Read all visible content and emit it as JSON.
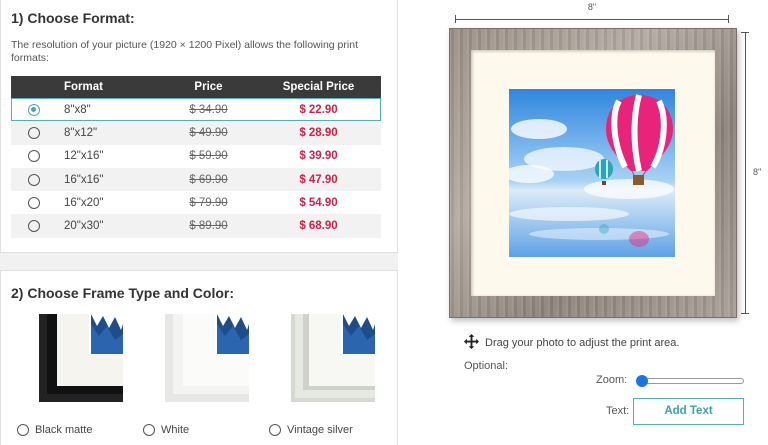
{
  "format_section": {
    "title": "1) Choose Format:",
    "description": "The resolution of your picture (1920 × 1200 Pixel) allows the following print formats:",
    "columns": [
      "Format",
      "Price",
      "Special Price"
    ],
    "rows": [
      {
        "format": "8\"x8\"",
        "price": "$ 34.90",
        "special": "$ 22.90",
        "selected": true
      },
      {
        "format": "8\"x12\"",
        "price": "$ 49.90",
        "special": "$ 28.90",
        "selected": false
      },
      {
        "format": "12\"x16\"",
        "price": "$ 59.90",
        "special": "$ 39.90",
        "selected": false
      },
      {
        "format": "16\"x16\"",
        "price": "$ 69.90",
        "special": "$ 47.90",
        "selected": false
      },
      {
        "format": "16\"x20\"",
        "price": "$ 79.90",
        "special": "$ 54.90",
        "selected": false
      },
      {
        "format": "20\"x30\"",
        "price": "$ 89.90",
        "special": "$ 68.90",
        "selected": false
      }
    ]
  },
  "frame_section": {
    "title": "2) Choose Frame Type and Color:",
    "options": [
      {
        "label": "Black matte"
      },
      {
        "label": "White"
      },
      {
        "label": "Vintage silver"
      }
    ]
  },
  "preview": {
    "width_label": "8\"",
    "height_label": "8\"",
    "drag_hint": "Drag your photo to adjust the print area.",
    "optional_label": "Optional:",
    "zoom_label": "Zoom:",
    "zoom_value": 0,
    "text_label": "Text:",
    "add_text_button": "Add Text"
  },
  "colors": {
    "accent": "#4db3b3",
    "special_price": "#d81b46",
    "header_bg": "#3a3a3a",
    "slider_thumb": "#1a73e8"
  }
}
